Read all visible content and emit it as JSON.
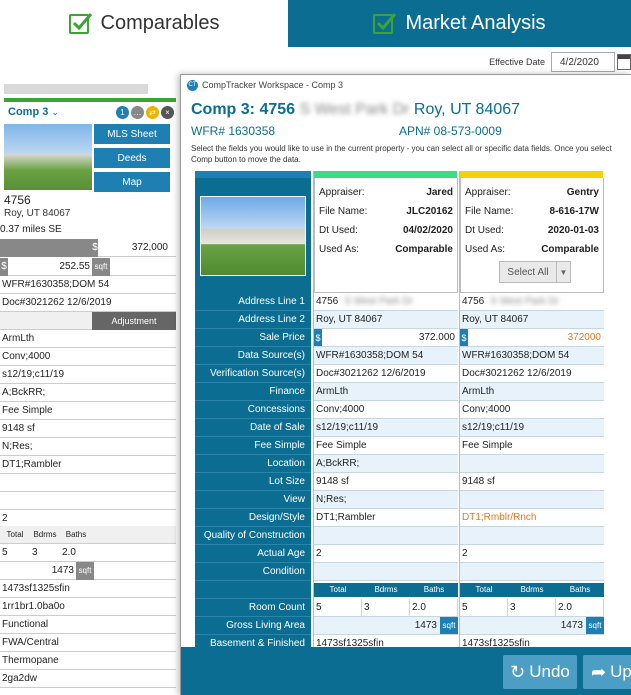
{
  "tabs": {
    "comparables": "Comparables",
    "market_analysis": "Market Analysis"
  },
  "effective_date": {
    "label": "Effective Date",
    "value": "4/2/2020"
  },
  "background_panel": {
    "comp_label": "Comp 3",
    "badge_count": "1",
    "buttons": [
      "MLS Sheet",
      "Deeds",
      "Map"
    ],
    "address_number": "4756",
    "city_line": "Roy, UT 84067",
    "distance": "0.37 miles SE",
    "price": "372,000",
    "price_per_sqft": "252.55",
    "sqft_unit": "sqft",
    "rows": [
      "WFR#1630358;DOM 54",
      "Doc#3021262 12/6/2019"
    ],
    "adjustment_label": "Adjustment",
    "lower_rows": [
      "ArmLth",
      "Conv;4000",
      "s12/19;c11/19",
      "A;BckRR;",
      "Fee Simple",
      "9148 sf",
      "N;Res;",
      "DT1;Rambler",
      "",
      "",
      "2"
    ],
    "room_headers": [
      "Total",
      "Bdrms",
      "Baths"
    ],
    "rooms": [
      "5",
      "3",
      "2.0"
    ],
    "gla": "1473",
    "bottom_rows": [
      "1473sf1325sfin",
      "1rr1br1.0ba0o",
      "Functional",
      "FWA/Central",
      "Thermopane",
      "2ga2dw"
    ]
  },
  "modal": {
    "title_bar": "CompTracker Workspace - Comp 3",
    "comp_prefix": "Comp 3: 4756",
    "street": "S West Park Dr",
    "city": "Roy, UT 84067",
    "wfr": "WFR# 1630358",
    "apn": "APN# 08-573-0009",
    "instructions_1": "Select the fields you would like to use in the current property - you can select all or specific data fields. Once you select",
    "instructions_2": "Comp button to move the data.",
    "labels": [
      "Address Line 1",
      "Address Line 2",
      "Sale Price",
      "Data Source(s)",
      "Verification Source(s)",
      "Finance",
      "Concessions",
      "Date of Sale",
      "Fee Simple",
      "Location",
      "Lot Size",
      "View",
      "Design/Style",
      "Quality of Construction",
      "Actual Age",
      "Condition",
      "",
      "Room Count",
      "Gross Living Area",
      "Basement & Finished"
    ],
    "header_labels": {
      "appraiser": "Appraiser:",
      "file_name": "File Name:",
      "dt_used": "Dt Used:",
      "used_as": "Used As:"
    },
    "select_all": "Select All",
    "room_headers": [
      "Total",
      "Bdrms",
      "Baths"
    ],
    "sqft_unit": "sqft",
    "col1": {
      "bar_color": "#3ddc84",
      "appraiser": "Jared",
      "file_name": "JLC20162",
      "dt_used": "04/02/2020",
      "used_as": "Comparable",
      "address1": "4756",
      "address2": "Roy, UT 84067",
      "sale_price": "372.000",
      "data_source": "WFR#1630358;DOM 54",
      "verification": "Doc#3021262 12/6/2019",
      "finance": "ArmLth",
      "concessions": "Conv;4000",
      "date_of_sale": "s12/19;c11/19",
      "fee_simple": "Fee Simple",
      "location": "A;BckRR;",
      "lot_size": "9148 sf",
      "view": "N;Res;",
      "design": "DT1;Rambler",
      "quality": "",
      "age": "2",
      "condition": "",
      "rooms": [
        "5",
        "3",
        "2.0"
      ],
      "gla": "1473",
      "basement": "1473sf1325sfin"
    },
    "col2": {
      "bar_color": "#f4d20a",
      "appraiser": "Gentry",
      "file_name": "8-616-17W",
      "dt_used": "2020-01-03",
      "used_as": "Comparable",
      "address1": "4756",
      "address2": "Roy, UT 84067",
      "sale_price": "372000",
      "data_source": "WFR#1630358;DOM 54",
      "verification": "Doc#3021262 12/6/2019",
      "finance": "ArmLth",
      "concessions": "Conv;4000",
      "date_of_sale": "s12/19;c11/19",
      "fee_simple": "Fee Simple",
      "location": "",
      "lot_size": "9148 sf",
      "view": "",
      "design": "DT1;Rmblr/Rnch",
      "quality": "",
      "age": "2",
      "condition": "",
      "rooms": [
        "5",
        "3",
        "2.0"
      ],
      "gla": "1473",
      "basement": "1473sf1325sfin"
    },
    "undo": "Undo",
    "up": "Up"
  }
}
